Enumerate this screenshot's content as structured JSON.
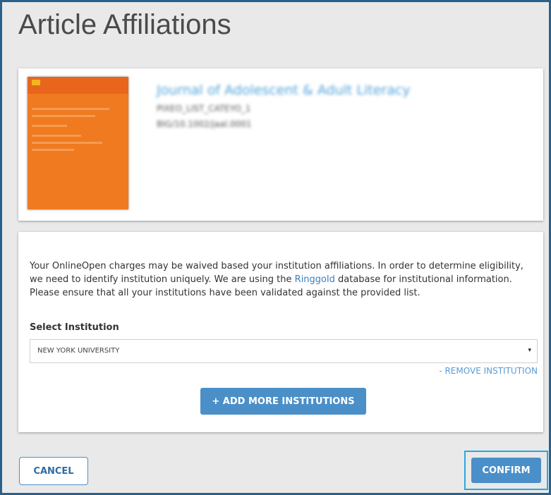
{
  "page": {
    "title": "Article Affiliations"
  },
  "journal": {
    "title": "Journal of Adolescent & Adult Literacy",
    "code": "PIXEO_LIST_CATEYO_1",
    "doi": "BIG/10.1002/jaal.0001",
    "cover_color": "#f07a20"
  },
  "affiliation": {
    "description_part1": "Your OnlineOpen charges may be waived based your institution affiliations. In order to determine eligibility, we need to identify institution uniquely. We are using the ",
    "ringgold_link": "Ringgold",
    "description_part2": " database for institutional information. Please ensure that all your institutions have been validated against the provided list.",
    "select_label": "Select Institution",
    "selected_institution": "NEW YORK UNIVERSITY",
    "caret_icon": "▾",
    "remove_label": "- REMOVE INSTITUTION",
    "add_label": "+ ADD MORE INSTITUTIONS"
  },
  "footer": {
    "cancel_label": "CANCEL",
    "confirm_label": "CONFIRM"
  },
  "colors": {
    "accent": "#4b8fc8",
    "link": "#3a7fbf",
    "focus_ring": "#29a8e0",
    "frame_border": "#2b5f8c"
  }
}
